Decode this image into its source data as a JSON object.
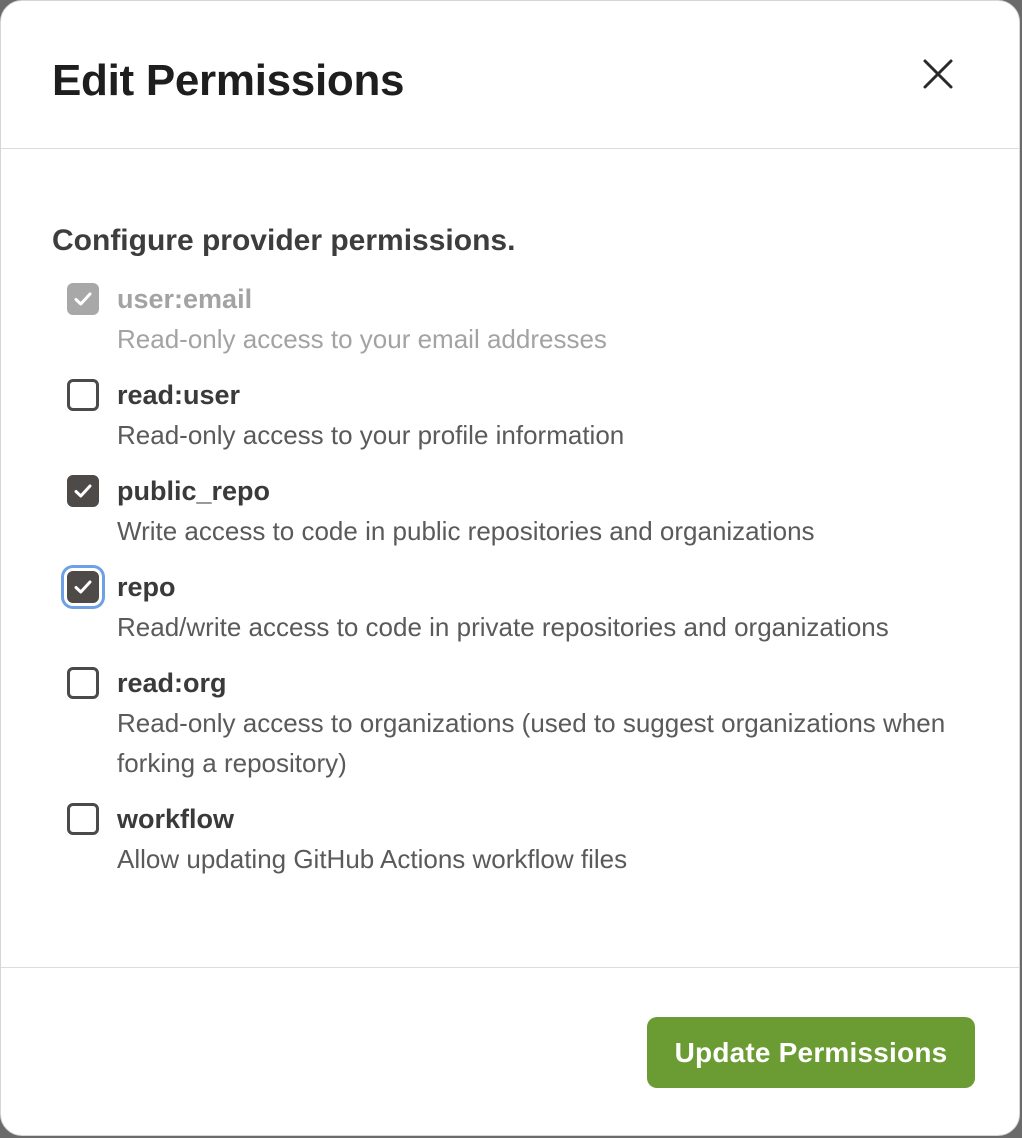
{
  "modal": {
    "title": "Edit Permissions",
    "close_label": "Close",
    "heading": "Configure provider permissions.",
    "permissions": [
      {
        "name": "user:email",
        "description": "Read-only access to your email addresses",
        "checked": true,
        "disabled": true,
        "focused": false
      },
      {
        "name": "read:user",
        "description": "Read-only access to your profile information",
        "checked": false,
        "disabled": false,
        "focused": false
      },
      {
        "name": "public_repo",
        "description": "Write access to code in public repositories and organizations",
        "checked": true,
        "disabled": false,
        "focused": false
      },
      {
        "name": "repo",
        "description": "Read/write access to code in private repositories and organizations",
        "checked": true,
        "disabled": false,
        "focused": true
      },
      {
        "name": "read:org",
        "description": "Read-only access to organizations (used to suggest organizations when forking a repository)",
        "checked": false,
        "disabled": false,
        "focused": false
      },
      {
        "name": "workflow",
        "description": "Allow updating GitHub Actions workflow files",
        "checked": false,
        "disabled": false,
        "focused": false
      }
    ],
    "submit_label": "Update Permissions"
  },
  "colors": {
    "primary_button": "#6b9c33",
    "checkbox_checked": "#4d4a47",
    "checkbox_disabled": "#a8a8a8",
    "focus_ring": "#6ea0e6"
  },
  "icons": {
    "close": "close-icon",
    "check": "checkmark-icon"
  }
}
